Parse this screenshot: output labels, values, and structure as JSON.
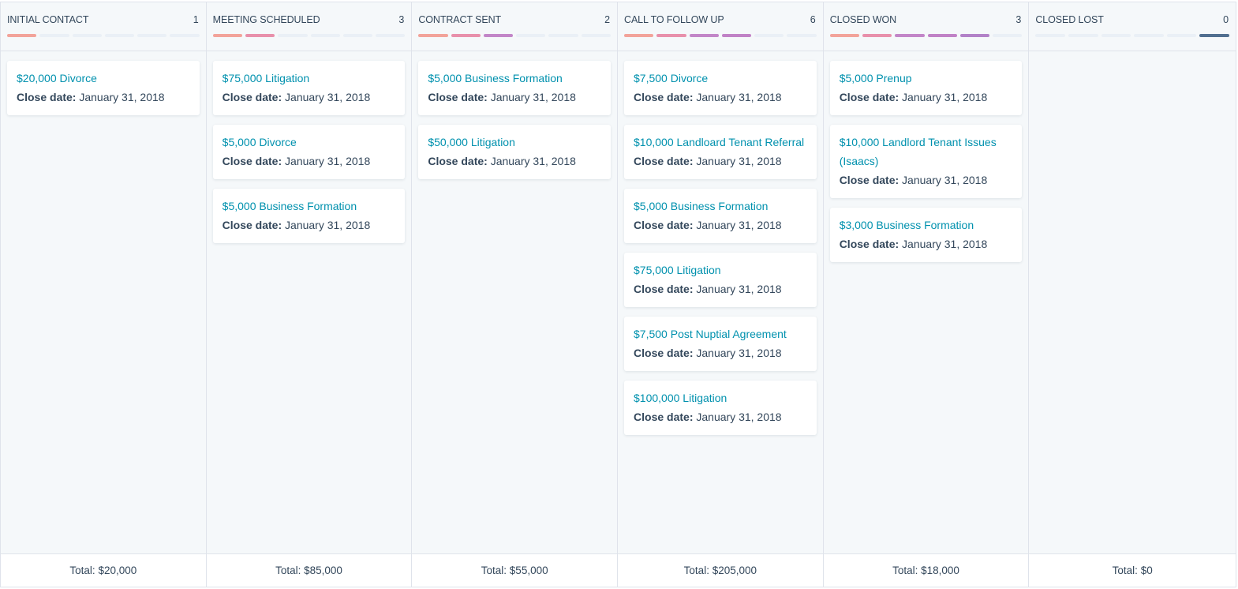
{
  "colors": {
    "stage1": "#f2a39a",
    "stage2": "#e890ab",
    "stage3": "#c286c8",
    "stage4": "#c082c6",
    "stage5": "#b282c8",
    "lost": "#516f90",
    "empty": "#eaf0f6",
    "link": "#0091ae"
  },
  "date_label": "Close date:",
  "total_label": "Total:",
  "columns": [
    {
      "title": "INITIAL CONTACT",
      "count": "1",
      "progress": [
        "stage1",
        "empty",
        "empty",
        "empty",
        "empty",
        "empty"
      ],
      "total": "$20,000",
      "deals": [
        {
          "name": "$20,000 Divorce",
          "close_date": "January 31, 2018"
        }
      ]
    },
    {
      "title": "MEETING SCHEDULED",
      "count": "3",
      "progress": [
        "stage1",
        "stage2",
        "empty",
        "empty",
        "empty",
        "empty"
      ],
      "total": "$85,000",
      "deals": [
        {
          "name": "$75,000 Litigation",
          "close_date": "January 31, 2018"
        },
        {
          "name": "$5,000 Divorce",
          "close_date": "January 31, 2018"
        },
        {
          "name": "$5,000 Business Formation",
          "close_date": "January 31, 2018"
        }
      ]
    },
    {
      "title": "CONTRACT SENT",
      "count": "2",
      "progress": [
        "stage1",
        "stage2",
        "stage3",
        "empty",
        "empty",
        "empty"
      ],
      "total": "$55,000",
      "deals": [
        {
          "name": "$5,000 Business Formation",
          "close_date": "January 31, 2018"
        },
        {
          "name": "$50,000 Litigation",
          "close_date": "January 31, 2018"
        }
      ]
    },
    {
      "title": "CALL TO FOLLOW UP",
      "count": "6",
      "progress": [
        "stage1",
        "stage2",
        "stage3",
        "stage4",
        "empty",
        "empty"
      ],
      "total": "$205,000",
      "deals": [
        {
          "name": "$7,500 Divorce",
          "close_date": "January 31, 2018"
        },
        {
          "name": "$10,000 Landloard Tenant Referral",
          "close_date": "January 31, 2018"
        },
        {
          "name": "$5,000 Business Formation",
          "close_date": "January 31, 2018"
        },
        {
          "name": "$75,000 Litigation",
          "close_date": "January 31, 2018"
        },
        {
          "name": "$7,500 Post Nuptial Agreement",
          "close_date": "January 31, 2018"
        },
        {
          "name": "$100,000 Litigation",
          "close_date": "January 31, 2018"
        }
      ]
    },
    {
      "title": "CLOSED WON",
      "count": "3",
      "progress": [
        "stage1",
        "stage2",
        "stage3",
        "stage4",
        "stage5",
        "empty"
      ],
      "total": "$18,000",
      "deals": [
        {
          "name": "$5,000 Prenup",
          "close_date": "January 31, 2018"
        },
        {
          "name": "$10,000 Landlord Tenant Issues (Isaacs)",
          "close_date": "January 31, 2018"
        },
        {
          "name": "$3,000 Business Formation",
          "close_date": "January 31, 2018"
        }
      ]
    },
    {
      "title": "CLOSED LOST",
      "count": "0",
      "progress": [
        "empty",
        "empty",
        "empty",
        "empty",
        "empty",
        "lost"
      ],
      "total": "$0",
      "deals": []
    }
  ]
}
